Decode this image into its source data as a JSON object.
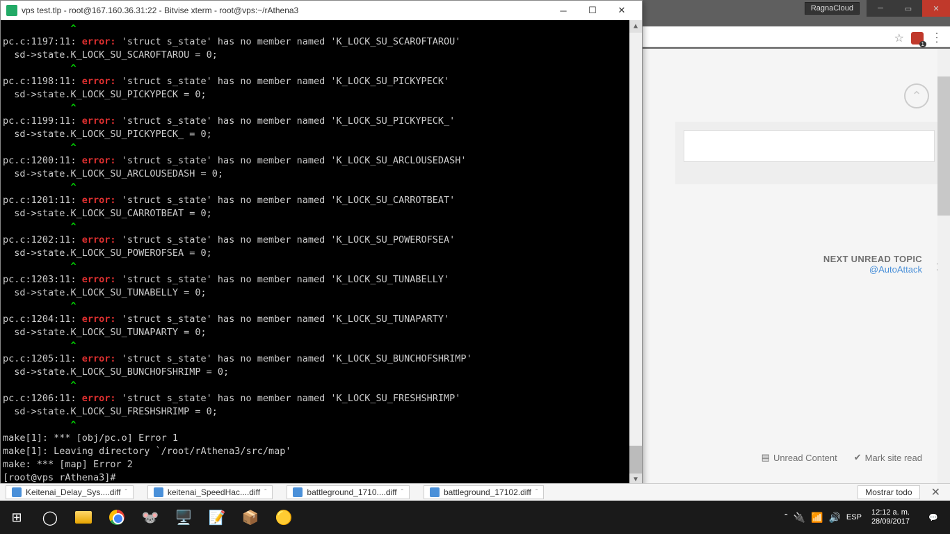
{
  "ragna_btn": "RagnaCloud",
  "terminal": {
    "title": "vps test.tlp - root@167.160.36.31:22 - Bitvise xterm - root@vps:~/rAthena3",
    "prompt": "[root@vps rAthena3]#",
    "errors": [
      {
        "loc": "pc.c:1197:11:",
        "msg": "'struct s_state' has no member named 'K_LOCK_SU_SCAROFTAROU'",
        "code": "  sd->state.K_LOCK_SU_SCAROFTAROU = 0;",
        "caret_col": 12
      },
      {
        "loc": "pc.c:1198:11:",
        "msg": "'struct s_state' has no member named 'K_LOCK_SU_PICKYPECK'",
        "code": "  sd->state.K_LOCK_SU_PICKYPECK = 0;",
        "caret_col": 12
      },
      {
        "loc": "pc.c:1199:11:",
        "msg": "'struct s_state' has no member named 'K_LOCK_SU_PICKYPECK_'",
        "code": "  sd->state.K_LOCK_SU_PICKYPECK_ = 0;",
        "caret_col": 12
      },
      {
        "loc": "pc.c:1200:11:",
        "msg": "'struct s_state' has no member named 'K_LOCK_SU_ARCLOUSEDASH'",
        "code": "  sd->state.K_LOCK_SU_ARCLOUSEDASH = 0;",
        "caret_col": 12
      },
      {
        "loc": "pc.c:1201:11:",
        "msg": "'struct s_state' has no member named 'K_LOCK_SU_CARROTBEAT'",
        "code": "  sd->state.K_LOCK_SU_CARROTBEAT = 0;",
        "caret_col": 12
      },
      {
        "loc": "pc.c:1202:11:",
        "msg": "'struct s_state' has no member named 'K_LOCK_SU_POWEROFSEA'",
        "code": "  sd->state.K_LOCK_SU_POWEROFSEA = 0;",
        "caret_col": 12
      },
      {
        "loc": "pc.c:1203:11:",
        "msg": "'struct s_state' has no member named 'K_LOCK_SU_TUNABELLY'",
        "code": "  sd->state.K_LOCK_SU_TUNABELLY = 0;",
        "caret_col": 12
      },
      {
        "loc": "pc.c:1204:11:",
        "msg": "'struct s_state' has no member named 'K_LOCK_SU_TUNAPARTY'",
        "code": "  sd->state.K_LOCK_SU_TUNAPARTY = 0;",
        "caret_col": 12
      },
      {
        "loc": "pc.c:1205:11:",
        "msg": "'struct s_state' has no member named 'K_LOCK_SU_BUNCHOFSHRIMP'",
        "code": "  sd->state.K_LOCK_SU_BUNCHOFSHRIMP = 0;",
        "caret_col": 12
      },
      {
        "loc": "pc.c:1206:11:",
        "msg": "'struct s_state' has no member named 'K_LOCK_SU_FRESHSHRIMP'",
        "code": "  sd->state.K_LOCK_SU_FRESHSHRIMP = 0;",
        "caret_col": 12
      }
    ],
    "tail": [
      "make[1]: *** [obj/pc.o] Error 1",
      "make[1]: Leaving directory `/root/rAthena3/src/map'",
      "make: *** [map] Error 2"
    ],
    "error_label": "error:"
  },
  "browser": {
    "next_topic_label": "NEXT UNREAD TOPIC",
    "next_topic_link": "@AutoAttack",
    "unread_content": "Unread Content",
    "mark_read": "Mark site read"
  },
  "downloads": {
    "items": [
      "Keitenai_Delay_Sys....diff",
      "keitenai_SpeedHac....diff",
      "battleground_1710....diff",
      "battleground_17102.diff"
    ],
    "show_all": "Mostrar todo"
  },
  "tray": {
    "lang": "ESP",
    "time": "12:12 a. m.",
    "date": "28/09/2017"
  }
}
